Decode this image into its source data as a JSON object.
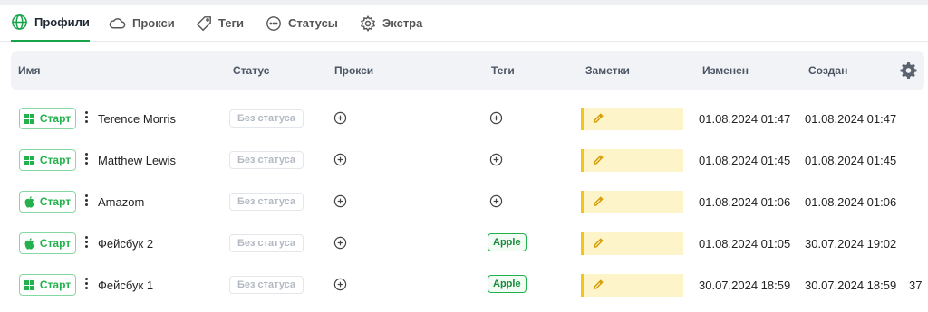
{
  "tabs": [
    {
      "label": "Профили",
      "icon": "globe-icon",
      "active": true
    },
    {
      "label": "Прокси",
      "icon": "cloud-icon",
      "active": false
    },
    {
      "label": "Теги",
      "icon": "tag-icon",
      "active": false
    },
    {
      "label": "Статусы",
      "icon": "dots-circle-icon",
      "active": false
    },
    {
      "label": "Экстра",
      "icon": "gear-icon",
      "active": false
    }
  ],
  "columns": {
    "name": "Имя",
    "status": "Статус",
    "proxy": "Прокси",
    "tags": "Теги",
    "notes": "Заметки",
    "modified": "Изменен",
    "created": "Создан"
  },
  "rows": [
    {
      "os": "windows",
      "start": "Старт",
      "name": "Terence Morris",
      "status": "Без статуса",
      "tag": "",
      "modified": "01.08.2024 01:47",
      "created": "01.08.2024 01:47",
      "extra": ""
    },
    {
      "os": "windows",
      "start": "Старт",
      "name": "Matthew Lewis",
      "status": "Без статуса",
      "tag": "",
      "modified": "01.08.2024 01:45",
      "created": "01.08.2024 01:45",
      "extra": ""
    },
    {
      "os": "apple",
      "start": "Старт",
      "name": "Amazom",
      "status": "Без статуса",
      "tag": "",
      "modified": "01.08.2024 01:06",
      "created": "01.08.2024 01:06",
      "extra": ""
    },
    {
      "os": "apple",
      "start": "Старт",
      "name": "Фейсбук 2",
      "status": "Без статуса",
      "tag": "Apple",
      "modified": "01.08.2024 01:05",
      "created": "30.07.2024 19:02",
      "extra": ""
    },
    {
      "os": "windows",
      "start": "Старт",
      "name": "Фейсбук 1",
      "status": "Без статуса",
      "tag": "Apple",
      "modified": "30.07.2024 18:59",
      "created": "30.07.2024 18:59",
      "extra": "37"
    }
  ],
  "colors": {
    "accent": "#16a34a",
    "start_text": "#22b14c",
    "note_bg": "#fdf5c9",
    "note_border": "#f3c51b"
  }
}
